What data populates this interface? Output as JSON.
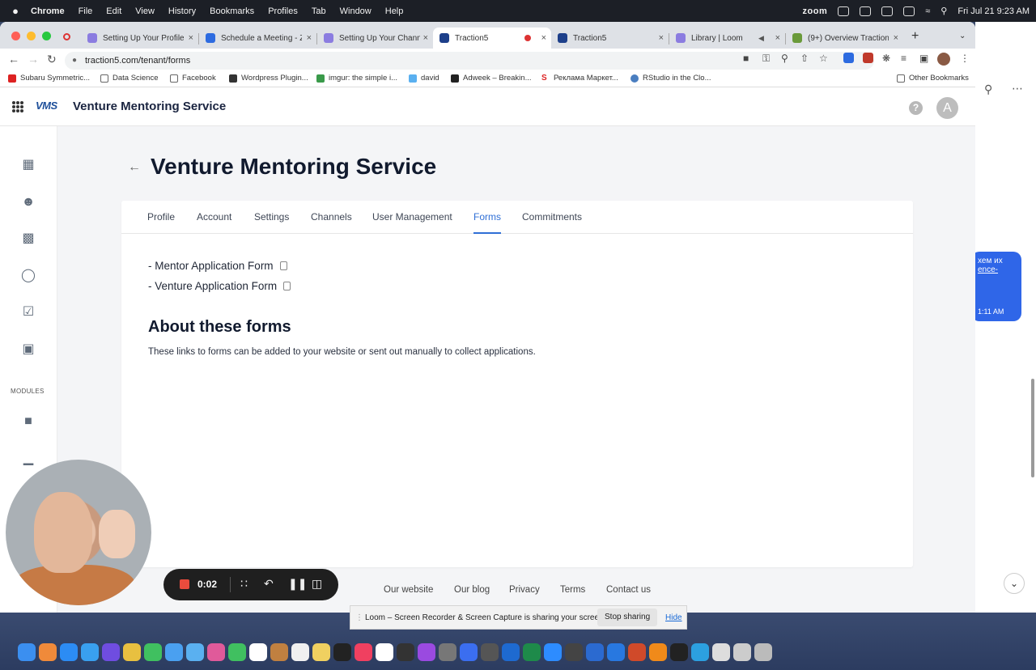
{
  "menubar": {
    "apple": "",
    "app": "Chrome",
    "items": [
      "File",
      "Edit",
      "View",
      "History",
      "Bookmarks",
      "Profiles",
      "Tab",
      "Window",
      "Help"
    ],
    "right_zoom": "zoom",
    "datetime": "Fri Jul 21  9:23 AM"
  },
  "browser": {
    "tabs": [
      {
        "title": "Setting Up Your Profile",
        "close": "×"
      },
      {
        "title": "Schedule a Meeting - Z",
        "close": "×"
      },
      {
        "title": "Setting Up Your Chann",
        "close": "×"
      },
      {
        "title": "Traction5",
        "close": "×"
      },
      {
        "title": "Traction5",
        "close": "×"
      },
      {
        "title": "Library | Loom",
        "close": "×"
      },
      {
        "title": "(9+) Overview Traction",
        "close": "×"
      }
    ],
    "new_tab": "+",
    "url": "traction5.com/tenant/forms",
    "bookmarks": [
      "Subaru Symmetric...",
      "Data Science",
      "Facebook",
      "Wordpress Plugin...",
      "imgur: the simple i...",
      "david",
      "Adweek – Breakin...",
      "Реклама Маркет...",
      "RStudio in the Clo..."
    ],
    "other_bookmarks": "Other Bookmarks"
  },
  "app": {
    "logo": "VMS",
    "title": "Venture Mentoring Service",
    "help": "?",
    "avatar": "A",
    "page_title": "Venture Mentoring Service",
    "modules_label": "MODULES",
    "tabs": [
      "Profile",
      "Account",
      "Settings",
      "Channels",
      "User Management",
      "Forms",
      "Commitments"
    ],
    "active_tab": "Forms",
    "forms": [
      "- Mentor Application Form",
      "- Venture Application Form"
    ],
    "about_heading": "About these forms",
    "about_text": "These links to forms can be added to your website or sent out manually to collect applications.",
    "footer": [
      "Our website",
      "Our blog",
      "Privacy",
      "Terms",
      "Contact us"
    ]
  },
  "loom": {
    "timer": "0:02",
    "share_message": "Loom – Screen Recorder & Screen Capture is sharing your screen.",
    "stop_sharing": "Stop sharing",
    "hide": "Hide"
  },
  "background_chat": {
    "line1": "хем их",
    "line2": "ence-",
    "time": "1:11 AM"
  },
  "colors": {
    "accent": "#2f6fd6",
    "title": "#111a2e",
    "loom_red": "#e84c3d"
  }
}
